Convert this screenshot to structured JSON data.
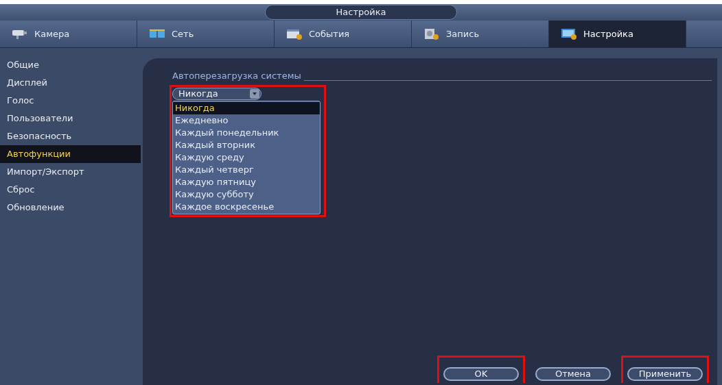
{
  "window": {
    "title": "Настройка"
  },
  "tabs": [
    {
      "label": "Камера",
      "selected": false
    },
    {
      "label": "Сеть",
      "selected": false
    },
    {
      "label": "События",
      "selected": false
    },
    {
      "label": "Запись",
      "selected": false
    },
    {
      "label": "Настройка",
      "selected": true
    }
  ],
  "sidebar": {
    "items": [
      {
        "label": "Общие",
        "selected": false
      },
      {
        "label": "Дисплей",
        "selected": false
      },
      {
        "label": "Голос",
        "selected": false
      },
      {
        "label": "Пользователи",
        "selected": false
      },
      {
        "label": "Безопасность",
        "selected": false
      },
      {
        "label": "Автофункции",
        "selected": true
      },
      {
        "label": "Импорт/Экспорт",
        "selected": false
      },
      {
        "label": "Сброс",
        "selected": false
      },
      {
        "label": "Обновление",
        "selected": false
      }
    ]
  },
  "section": {
    "title": "Автоперезагрузка системы",
    "dropdown": {
      "value": "Никогда",
      "options": [
        {
          "label": "Никогда",
          "selected": true
        },
        {
          "label": "Ежедневно",
          "selected": false
        },
        {
          "label": "Каждый понедельник",
          "selected": false
        },
        {
          "label": "Каждый вторник",
          "selected": false
        },
        {
          "label": "Каждую среду",
          "selected": false
        },
        {
          "label": "Каждый четверг",
          "selected": false
        },
        {
          "label": "Каждую пятницу",
          "selected": false
        },
        {
          "label": "Каждую субботу",
          "selected": false
        },
        {
          "label": "Каждое воскресенье",
          "selected": false
        }
      ]
    }
  },
  "buttons": [
    {
      "label": "OK",
      "highlighted": true
    },
    {
      "label": "Отмена",
      "highlighted": false
    },
    {
      "label": "Применить",
      "highlighted": true
    }
  ]
}
